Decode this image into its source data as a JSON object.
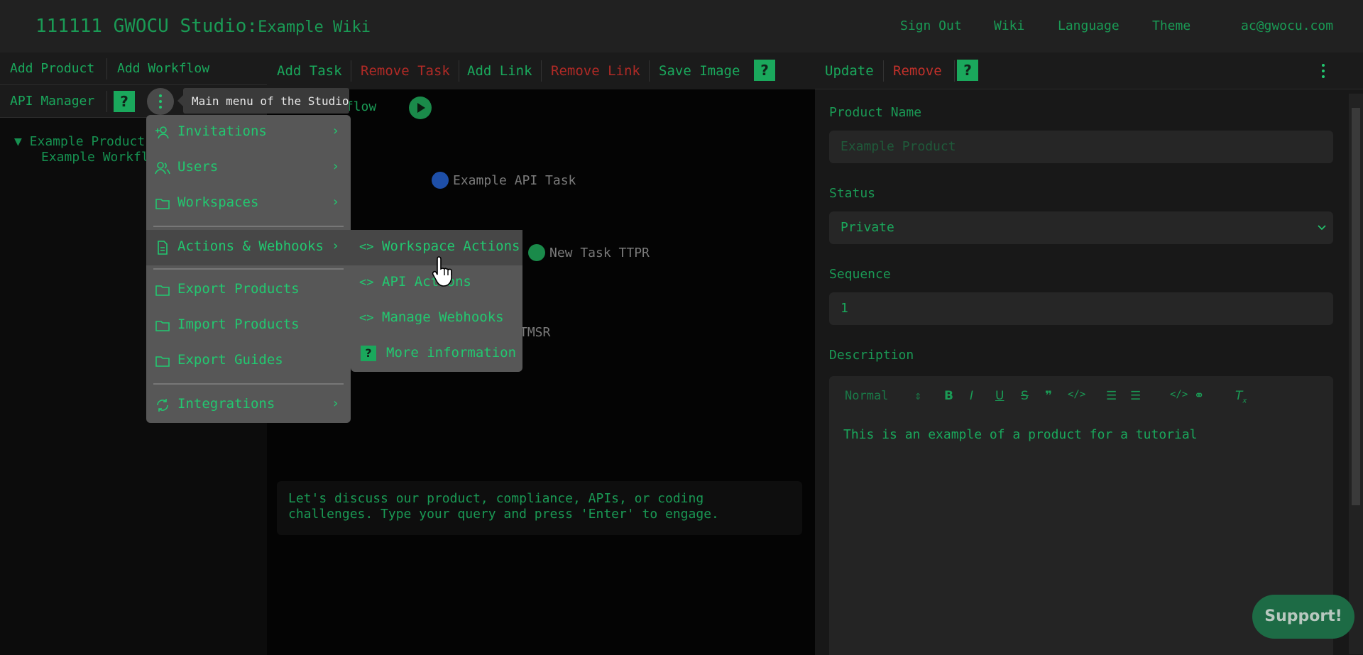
{
  "header": {
    "app_title": "111111 GWOCU Studio:",
    "workspace_name": "Example Wiki",
    "nav": [
      "Sign Out",
      "Wiki",
      "Language",
      "Theme",
      "ac@gwocu.com"
    ]
  },
  "left_toolbar": {
    "add_product": "Add Product",
    "add_workflow": "Add Workflow",
    "api_manager": "API Manager",
    "help": "?"
  },
  "tree": {
    "product": "▼ Example Product",
    "workflow": "Example Workflow"
  },
  "tooltip": "Main menu of the Studio",
  "main_menu": {
    "items": [
      {
        "icon": "user-plus-icon",
        "label": "Invitations",
        "has_submenu": true
      },
      {
        "icon": "users-icon",
        "label": "Users",
        "has_submenu": true
      },
      {
        "icon": "folder-icon",
        "label": "Workspaces",
        "has_submenu": true
      },
      {
        "icon": "document-icon",
        "label": "Actions & Webhooks",
        "has_submenu": true,
        "active": true
      },
      {
        "icon": "folder-icon",
        "label": "Export Products",
        "has_submenu": false
      },
      {
        "icon": "folder-icon",
        "label": "Import Products",
        "has_submenu": false
      },
      {
        "icon": "folder-icon",
        "label": "Export Guides",
        "has_submenu": false
      },
      {
        "icon": "sync-icon",
        "label": "Integrations",
        "has_submenu": true
      }
    ],
    "chevron": "›"
  },
  "submenu": {
    "items": [
      {
        "icon": "code-icon",
        "label": "Workspace Actions"
      },
      {
        "icon": "code-icon",
        "label": "API Actions"
      },
      {
        "icon": "code-icon",
        "label": "Manage Webhooks"
      },
      {
        "icon": "help-icon",
        "label": "More information"
      }
    ],
    "code_glyph": "<>",
    "help_glyph": "?"
  },
  "center_toolbar": {
    "add_task": "Add Task",
    "remove_task": "Remove Task",
    "add_link": "Add Link",
    "remove_link": "Remove Link",
    "save_image": "Save Image",
    "help": "?"
  },
  "workflow": {
    "title_partial": "kflow",
    "nodes": [
      {
        "label": "Example API Task",
        "color": "#1e4fa8"
      },
      {
        "label": "New Task TTPR",
        "color": "#1a8a4a"
      },
      {
        "label": "TMSR",
        "color": "#1a8a4a"
      }
    ]
  },
  "chat": {
    "placeholder": "Let's discuss our product, compliance, APIs, or coding challenges. Type your query and press 'Enter' to engage."
  },
  "right_toolbar": {
    "update": "Update",
    "remove": "Remove",
    "help": "?"
  },
  "details": {
    "product_name_label": "Product Name",
    "product_name_placeholder": "Example Product",
    "status_label": "Status",
    "status_value": "Private",
    "sequence_label": "Sequence",
    "sequence_value": "1",
    "description_label": "Description",
    "editor_format": "Normal",
    "description_text": "This is an example of a product for a tutorial"
  },
  "support_button": "Support!",
  "colors": {
    "accent": "#22c870",
    "danger": "#c0302a",
    "header_bg": "#212121",
    "menu_bg": "#575757"
  }
}
